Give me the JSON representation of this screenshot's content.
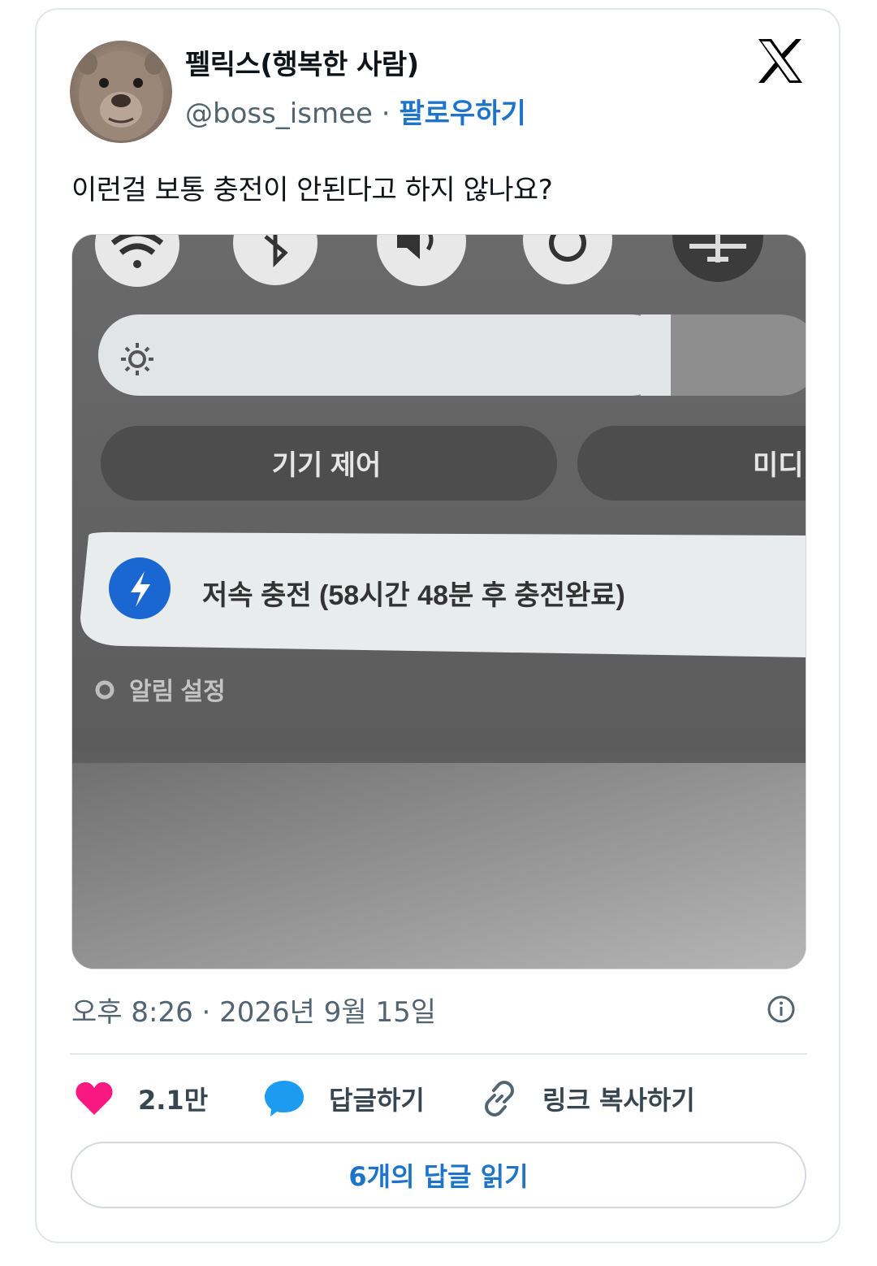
{
  "user": {
    "display_name": "펠릭스(행복한 사람)",
    "handle": "@boss_ismee",
    "separator": "·",
    "follow_label": "팔로우하기",
    "avatar_icon": "animal-avatar"
  },
  "tweet": {
    "text": "이런걸 보통 충전이 안된다고 하지 않나요?"
  },
  "photo": {
    "brightness_label_icon": "sun-icon",
    "device_control_label": "기기 제어",
    "media_label_cut": "미디",
    "notification_text": "저속 충전 (58시간 48분 후 충전완료)",
    "notification_settings_label": "알림 설정",
    "brightness_level": 0.8
  },
  "meta": {
    "timestamp": "오후 8:26 · 2026년 9월 15일"
  },
  "actions": {
    "likes": "2.1만",
    "reply_label": "답글하기",
    "copy_link_label": "링크 복사하기"
  },
  "read_replies_label": "6개의 답글 읽기",
  "colors": {
    "like": "#f91880",
    "reply": "#1d9bf0",
    "link_blue": "#1d74c9",
    "muted": "#536471"
  }
}
